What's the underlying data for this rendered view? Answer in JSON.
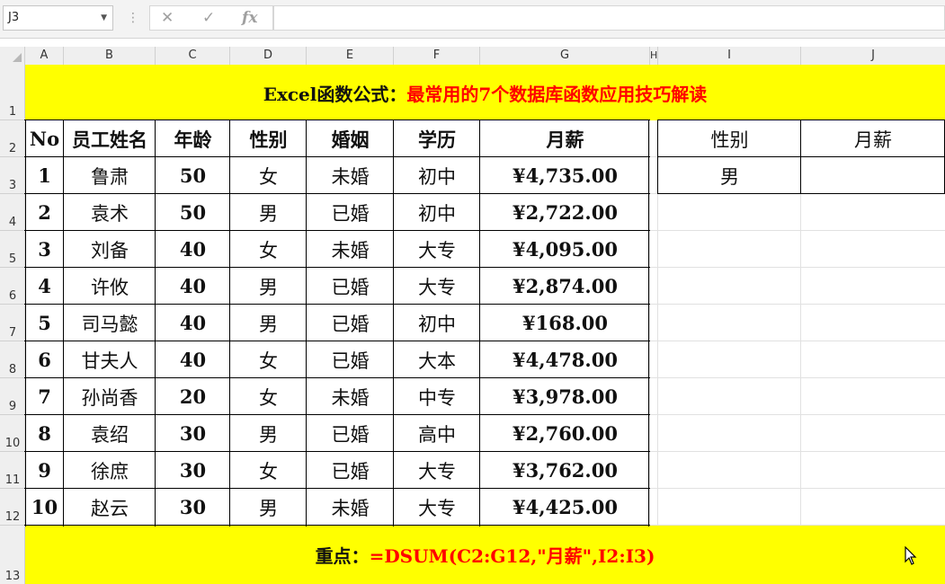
{
  "namebox": {
    "value": "J3"
  },
  "formula_bar": {
    "cancel_icon": "✕",
    "enter_icon": "✓",
    "fx_label": "fx",
    "content": ""
  },
  "columns": [
    "A",
    "B",
    "C",
    "D",
    "E",
    "F",
    "G",
    "H",
    "I",
    "J"
  ],
  "rows": [
    "1",
    "2",
    "3",
    "4",
    "5",
    "6",
    "7",
    "8",
    "9",
    "10",
    "11",
    "12",
    "13"
  ],
  "title": {
    "prefix": "Excel函数公式：",
    "text": "最常用的7个数据库函数应用技巧解读"
  },
  "table": {
    "headers": [
      "No",
      "员工姓名",
      "年龄",
      "性别",
      "婚姻",
      "学历",
      "月薪"
    ],
    "rows": [
      [
        "1",
        "鲁肃",
        "50",
        "女",
        "未婚",
        "初中",
        "¥4,735.00"
      ],
      [
        "2",
        "袁术",
        "50",
        "男",
        "已婚",
        "初中",
        "¥2,722.00"
      ],
      [
        "3",
        "刘备",
        "40",
        "女",
        "未婚",
        "大专",
        "¥4,095.00"
      ],
      [
        "4",
        "许攸",
        "40",
        "男",
        "已婚",
        "大专",
        "¥2,874.00"
      ],
      [
        "5",
        "司马懿",
        "40",
        "男",
        "已婚",
        "初中",
        "¥168.00"
      ],
      [
        "6",
        "甘夫人",
        "40",
        "女",
        "已婚",
        "大本",
        "¥4,478.00"
      ],
      [
        "7",
        "孙尚香",
        "20",
        "女",
        "未婚",
        "中专",
        "¥3,978.00"
      ],
      [
        "8",
        "袁绍",
        "30",
        "男",
        "已婚",
        "高中",
        "¥2,760.00"
      ],
      [
        "9",
        "徐庶",
        "30",
        "女",
        "已婚",
        "大专",
        "¥3,762.00"
      ],
      [
        "10",
        "赵云",
        "30",
        "男",
        "未婚",
        "大专",
        "¥4,425.00"
      ]
    ]
  },
  "criteria": {
    "headers": [
      "性别",
      "月薪"
    ],
    "values": [
      "男",
      ""
    ]
  },
  "footer": {
    "label": "重点：",
    "formula": "=DSUM(C2:G12,\"月薪\",I2:I3)"
  },
  "colors": {
    "highlight": "#ffff00",
    "accent_text": "#ff0000"
  }
}
